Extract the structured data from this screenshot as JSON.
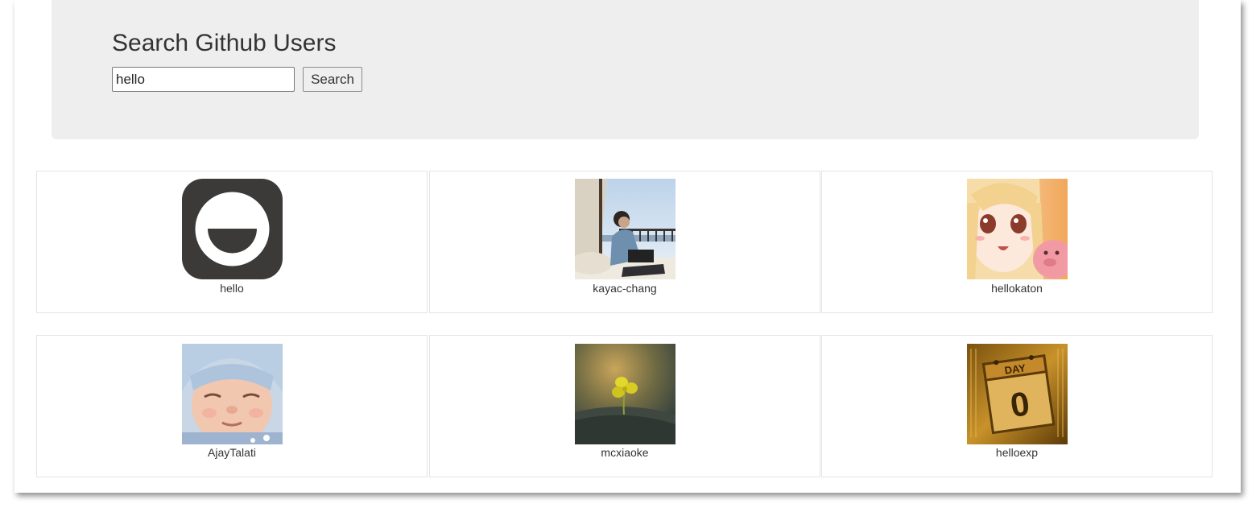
{
  "header": {
    "title": "Search Github Users",
    "search_value": "hello",
    "search_button_label": "Search"
  },
  "users": [
    {
      "login": "hello",
      "avatar": "hello-logo-avatar"
    },
    {
      "login": "kayac-chang",
      "avatar": "person-on-balcony-photo-avatar"
    },
    {
      "login": "hellokaton",
      "avatar": "anime-girl-avatar"
    },
    {
      "login": "AjayTalati",
      "avatar": "baby-photo-avatar"
    },
    {
      "login": "mcxiaoke",
      "avatar": "clover-photo-avatar"
    },
    {
      "login": "helloexp",
      "avatar": "day-zero-calendar-avatar"
    }
  ],
  "colors": {
    "jumbotron_bg": "#eeeeee",
    "text": "#333333",
    "card_border": "#e4e4e4"
  }
}
